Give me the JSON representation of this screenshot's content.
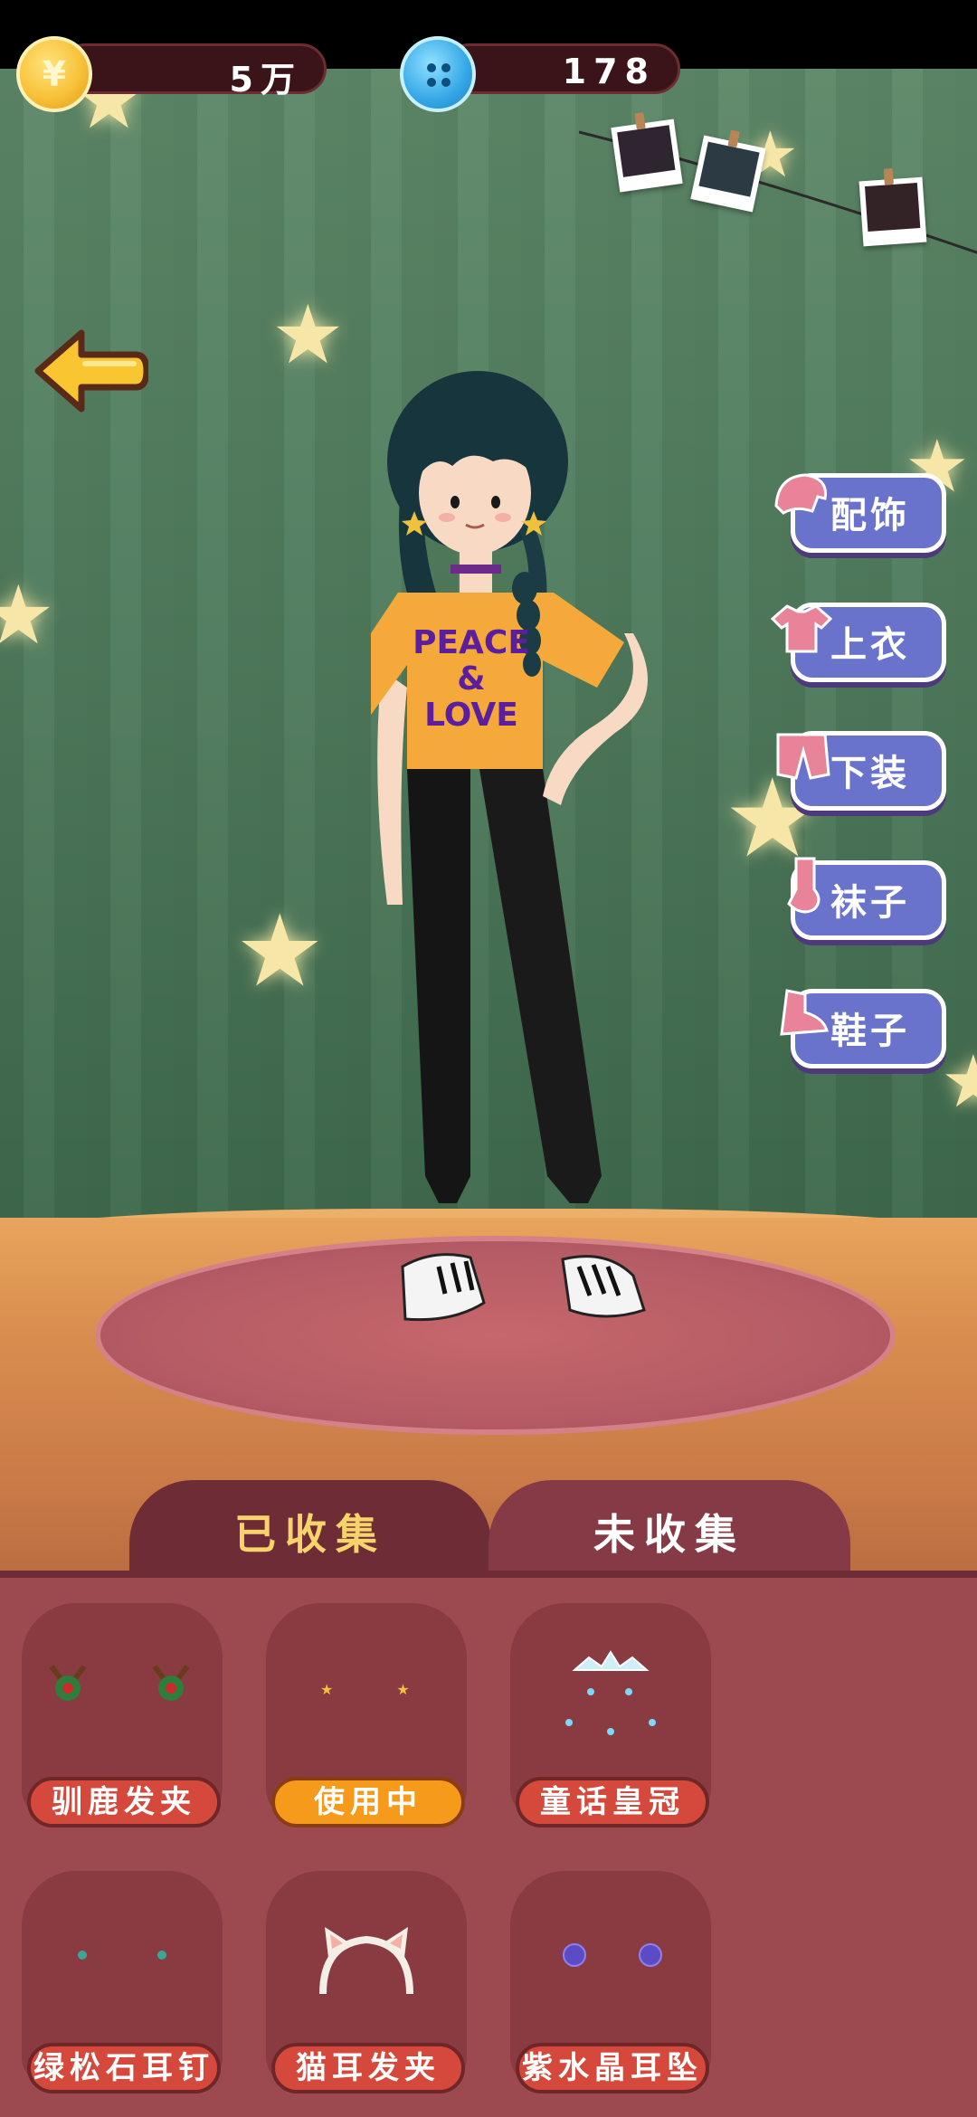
{
  "currency": {
    "coins": "5万",
    "buttons": "178"
  },
  "categories": [
    {
      "label": "配饰",
      "icon": "hat-icon"
    },
    {
      "label": "上衣",
      "icon": "shirt-icon"
    },
    {
      "label": "下装",
      "icon": "pants-icon"
    },
    {
      "label": "袜子",
      "icon": "sock-icon"
    },
    {
      "label": "鞋子",
      "icon": "shoe-icon"
    }
  ],
  "shirt_text": {
    "line1": "PEACE",
    "line2": "&",
    "line3": "LOVE"
  },
  "tabs": {
    "collected": "已收集",
    "uncollected": "未收集"
  },
  "items": [
    {
      "name": "驯鹿发夹",
      "active": false
    },
    {
      "name": "使用中",
      "active": true
    },
    {
      "name": "童话皇冠",
      "active": false
    },
    {
      "name": "绿松石耳钉",
      "active": false
    },
    {
      "name": "猫耳发夹",
      "active": false
    },
    {
      "name": "紫水晶耳坠",
      "active": false
    }
  ],
  "colors": {
    "tab_active_text": "#f7d36b",
    "panel": "#9c4a50",
    "category_pill": "#6a73cc",
    "in_use_button": "#f59a1b"
  }
}
